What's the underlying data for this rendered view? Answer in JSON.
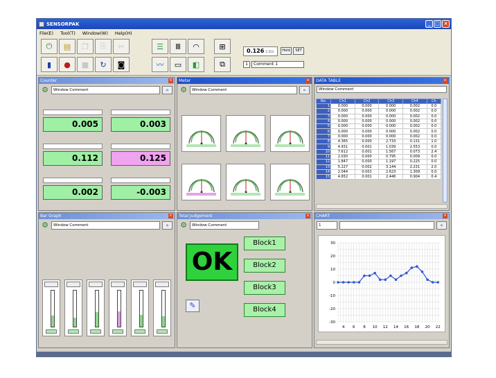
{
  "window": {
    "title": "SENSORPAK"
  },
  "menu": [
    "File(E)",
    "Tool(T)",
    "Window(W)",
    "Help(H)"
  ],
  "toolbar": {
    "icons_row1": [
      "power-icon",
      "save-icon",
      "copy-icon",
      "paste-icon",
      "settings-icon",
      "counter-view-icon",
      "bar-view-icon",
      "meter-view-icon",
      "grid-view-icon"
    ],
    "icons_row2": [
      "pause-icon",
      "record-icon",
      "stop-icon",
      "refresh-icon",
      "camera-icon",
      "chart-view-icon",
      "table-view-icon",
      "judge-view-icon",
      "window-icon"
    ],
    "readout_value": "0.126",
    "readout_unit": "Z.Z03",
    "hold_label": "Hold",
    "set_label": "SET",
    "comment_num": "1",
    "comment_text": "Comment 1"
  },
  "panels": {
    "counter": {
      "title": "Counter",
      "comment": "Window Comment",
      "values": [
        "0.005",
        "0.003",
        "0.112",
        "0.125",
        "0.002",
        "-0.003"
      ]
    },
    "meter": {
      "title": "Meter",
      "comment": "Window Comment"
    },
    "data_table": {
      "title": "DATA TABLE",
      "comment": "Window Comment",
      "headers": [
        "No.",
        "Ch1",
        "Ch2",
        "Ch3",
        "Ch4",
        "Ch"
      ],
      "rows": [
        [
          "1",
          "0.000",
          "0.000",
          "0.000",
          "0.002",
          "0.0"
        ],
        [
          "2",
          "0.000",
          "0.000",
          "0.000",
          "0.002",
          "0.0"
        ],
        [
          "3",
          "0.000",
          "0.000",
          "0.000",
          "0.002",
          "0.0"
        ],
        [
          "4",
          "0.000",
          "0.000",
          "0.000",
          "0.002",
          "0.0"
        ],
        [
          "5",
          "0.000",
          "0.000",
          "0.000",
          "0.002",
          "0.0"
        ],
        [
          "6",
          "0.000",
          "0.000",
          "0.000",
          "0.002",
          "0.0"
        ],
        [
          "7",
          "0.000",
          "0.000",
          "0.000",
          "0.002",
          "0.0"
        ],
        [
          "8",
          "4.365",
          "0.000",
          "2.733",
          "0.131",
          "1.0"
        ],
        [
          "9",
          "4.931",
          "0.001",
          "1.039",
          "2.553",
          "0.0"
        ],
        [
          "10",
          "7.612",
          "0.001",
          "1.567",
          "0.073",
          "2.4"
        ],
        [
          "11",
          "2.030",
          "0.000",
          "0.795",
          "0.009",
          "0.0"
        ],
        [
          "12",
          "1.847",
          "0.000",
          "1.197",
          "0.225",
          "0.0"
        ],
        [
          "13",
          "5.227",
          "0.002",
          "3.144",
          "2.231",
          "2.0"
        ],
        [
          "14",
          "2.044",
          "0.001",
          "2.623",
          "1.309",
          "0.0"
        ],
        [
          "15",
          "4.652",
          "0.001",
          "2.446",
          "0.904",
          "0.4"
        ]
      ]
    },
    "bar_graph": {
      "title": "Bar Graph",
      "comment": "Window Comment"
    },
    "judgement": {
      "title": "Total Judgement",
      "comment": "Window Comment",
      "result": "OK",
      "blocks": [
        "Block1",
        "Block2",
        "Block3",
        "Block4"
      ]
    },
    "chart": {
      "title": "CHART",
      "channel": "1"
    }
  },
  "chart_data": {
    "type": "line",
    "x": [
      3,
      4,
      5,
      6,
      7,
      8,
      9,
      10,
      11,
      12,
      13,
      14,
      15,
      16,
      17,
      18,
      19,
      20,
      21,
      22
    ],
    "values": [
      0,
      0,
      0,
      0,
      0,
      5,
      5,
      7,
      2,
      2,
      5,
      2,
      5,
      7,
      11,
      12,
      8,
      2,
      0,
      0
    ],
    "xticks": [
      "4",
      "6",
      "8",
      "10",
      "12",
      "14",
      "16",
      "18",
      "20",
      "22"
    ],
    "yticks": [
      "30",
      "20",
      "10",
      "0",
      "-10",
      "-20",
      "-30"
    ],
    "xlim": [
      3,
      22.5
    ],
    "ylim": [
      -30,
      30
    ],
    "grid": true,
    "color": "#2f55d4"
  }
}
